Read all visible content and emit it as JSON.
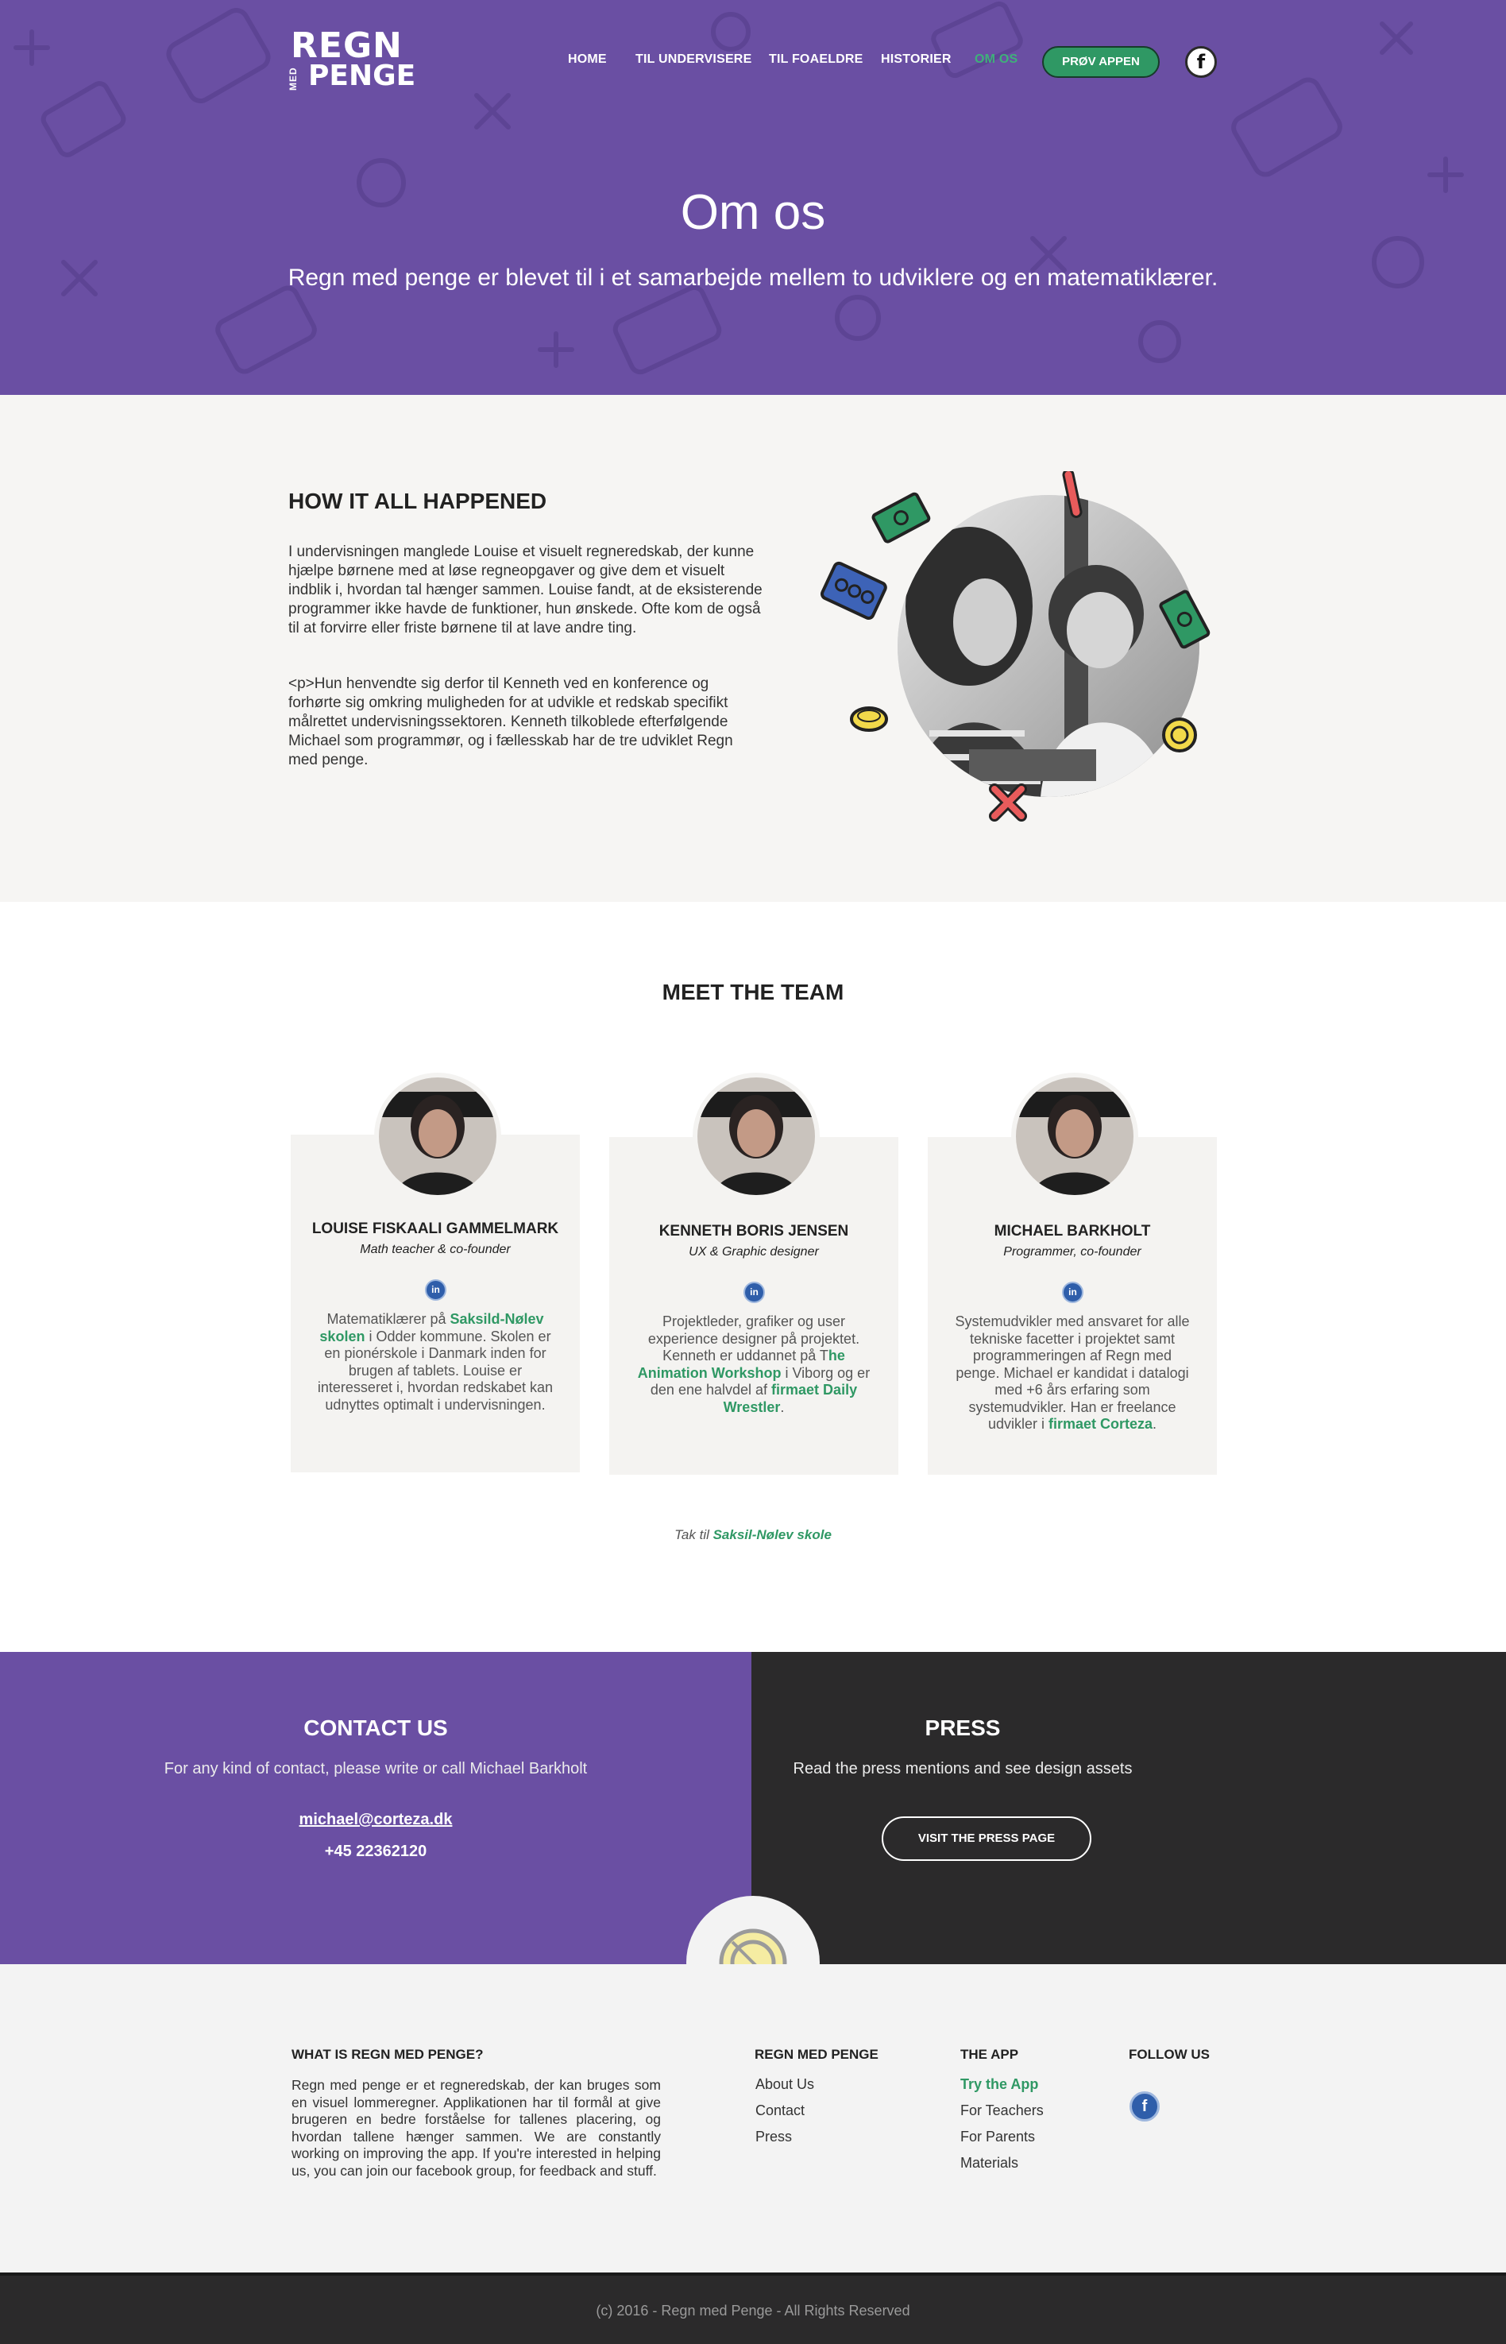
{
  "brand": {
    "logo_line1": "REGN",
    "logo_small": "MED",
    "logo_line2": "PENGE"
  },
  "nav": {
    "items": [
      {
        "label": "HOME"
      },
      {
        "label": "TIL UNDERVISERE"
      },
      {
        "label": "TIL FOAELDRE"
      },
      {
        "label": "HISTORIER"
      },
      {
        "label": "OM OS"
      }
    ],
    "active": "OM OS",
    "cta_label": "PRØV APPEN",
    "facebook_glyph": "f"
  },
  "hero": {
    "title": "Om os",
    "subtitle": "Regn med penge er blevet til i et samarbejde mellem to udviklere og en matematiklærer."
  },
  "story": {
    "heading": "HOW IT ALL HAPPENED",
    "paragraph1": "I undervisningen manglede Louise et visuelt regneredskab, der kunne hjælpe børnene med at løse regneopgaver og give dem et visuelt indblik i, hvordan tal hænger sammen. Louise fandt, at de eksisterende programmer ikke havde de funktioner, hun ønskede. Ofte kom de også til at forvirre eller friste børnene til at lave andre ting.",
    "paragraph2": "<p>Hun henvendte sig derfor til Kenneth ved en konference og forhørte sig omkring muligheden for at udvikle et redskab specifikt målrettet undervisningssektoren. Kenneth tilkoblede efterfølgende Michael som programmør, og i fællesskab har de tre udviklet Regn med penge."
  },
  "team": {
    "heading": "MEET THE TEAM",
    "linkedin_glyph": "in",
    "members": [
      {
        "name": "LOUISE FISKAALI GAMMELMARK",
        "role": "Math teacher & co-founder",
        "bio_pre": "Matematiklærer på ",
        "bio_link": "Saksild-Nølev skolen",
        "bio_post": " i Odder kommune. Skolen er en pionérskole i Danmark inden for brugen af tablets. Louise er interesseret i, hvordan redskabet kan udnyttes optimalt i undervisningen."
      },
      {
        "name": "KENNETH BORIS JENSEN",
        "role": "UX & Graphic designer",
        "bio_pre": "Projektleder, grafiker og user experience designer på projektet. Kenneth er uddannet på T",
        "bio_link": "he Animation Workshop",
        "bio_mid": " i Viborg og er den ene halvdel af ",
        "bio_link2": "firmaet Daily Wrestler",
        "bio_post": "."
      },
      {
        "name": "MICHAEL BARKHOLT",
        "role": "Programmer, co-founder",
        "bio_pre": "Systemudvikler med ansvaret for alle tekniske facetter i projektet samt programmeringen af Regn med penge. Michael er kandidat i datalogi med +6 års erfaring som systemudvikler. Han er freelance udvikler i ",
        "bio_link": "firmaet Corteza",
        "bio_post": "."
      }
    ],
    "thanks_pre": "Tak til",
    "thanks_link": " Saksil-Nølev skole"
  },
  "contact": {
    "heading": "CONTACT US",
    "subtitle": "For any kind of contact, please write or call Michael Barkholt",
    "email": "michael@corteza.dk",
    "phone": "+45 22362120"
  },
  "press": {
    "heading": "PRESS",
    "subtitle": "Read the press mentions and see design assets",
    "button_label": "VISIT THE PRESS PAGE"
  },
  "footer": {
    "about_heading": "WHAT IS REGN MED PENGE?",
    "about_text": "Regn med penge er et regneredskab, der kan bruges som en visuel lommeregner. Applikationen har til formål at give brugeren en bedre forståelse for tallenes placering, og hvordan tallene hænger sammen. We are constantly working on improving the app. If you're interested in helping us, you can join our facebook group, for feedback and stuff.",
    "col1_heading": "REGN MED PENGE",
    "col1_links": [
      "About Us",
      "Contact",
      "Press"
    ],
    "col2_heading": "THE APP",
    "col2_links": [
      "Try the App",
      "For Teachers",
      "For Parents",
      "Materials"
    ],
    "col3_heading": "FOLLOW US",
    "facebook_glyph": "f",
    "copyright": "(c)  2016 - Regn med Penge  - All Rights Reserved"
  },
  "colors": {
    "purple": "#6a4fa3",
    "green": "#2f9864",
    "dark": "#2b2a2b",
    "light_bg": "#f6f5f3"
  }
}
